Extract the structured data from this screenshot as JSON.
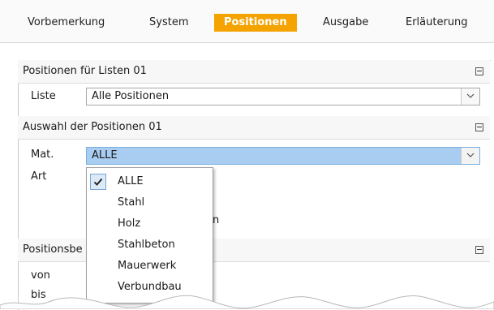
{
  "tabs": [
    {
      "label": "Vorbemerkung"
    },
    {
      "label": "System"
    },
    {
      "label": "Positionen",
      "active": true
    },
    {
      "label": "Ausgabe"
    },
    {
      "label": "Erläuterung"
    }
  ],
  "sections": {
    "positionen_listen": {
      "title": "Positionen für Listen 01",
      "liste_label": "Liste",
      "liste_value": "Alle Positionen"
    },
    "auswahl": {
      "title": "Auswahl der Positionen 01",
      "mat_label": "Mat.",
      "mat_value": "ALLE",
      "art_label": "Art",
      "hidden_fragment": "n"
    },
    "positionsbereich": {
      "title_visible": "Positionsbe",
      "von_label": "von",
      "bis_label": "bis"
    }
  },
  "dropdown": {
    "options": [
      {
        "label": "ALLE",
        "checked": true
      },
      {
        "label": "Stahl"
      },
      {
        "label": "Holz"
      },
      {
        "label": "Stahlbeton"
      },
      {
        "label": "Mauerwerk"
      },
      {
        "label": "Verbundbau"
      }
    ]
  },
  "colors": {
    "active_tab": "#f4a300",
    "selected_field": "#a9ccf1"
  }
}
